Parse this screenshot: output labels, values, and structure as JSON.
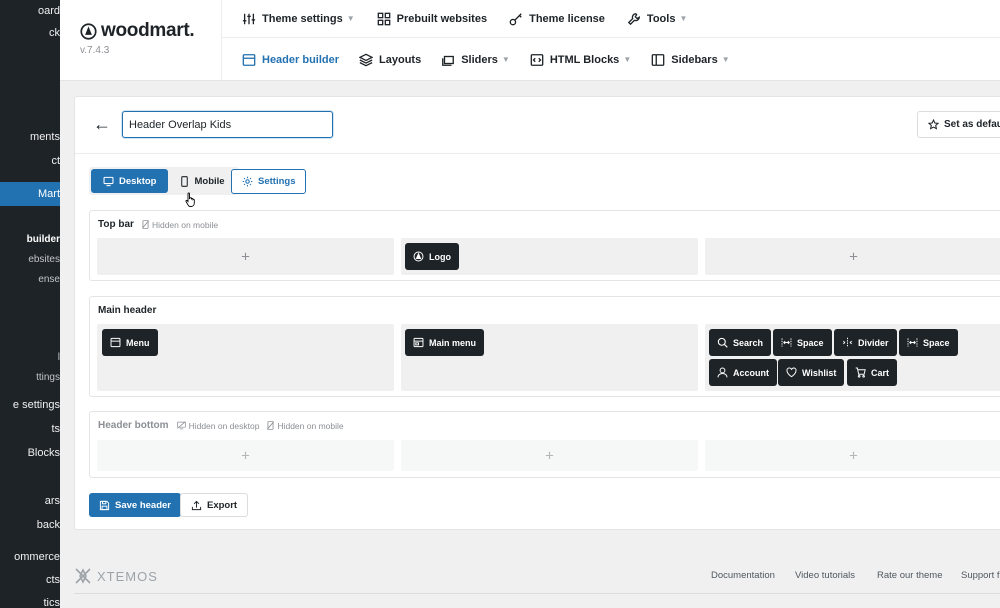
{
  "admin_menu": {
    "items": [
      {
        "label": "oard"
      },
      {
        "label": "ck"
      },
      {
        "label": "ments"
      },
      {
        "label": "ct"
      },
      {
        "label": "Mart"
      },
      {
        "label": "builder"
      },
      {
        "label": "ebsites"
      },
      {
        "label": "ense"
      },
      {
        "label": "l"
      },
      {
        "label": "ttings"
      },
      {
        "label": "e settings"
      },
      {
        "label": "ts"
      },
      {
        "label": " Blocks"
      },
      {
        "label": "ars"
      },
      {
        "label": "back"
      },
      {
        "label": "ommerce"
      },
      {
        "label": "cts"
      },
      {
        "label": "tics"
      }
    ]
  },
  "brand": {
    "name": "woodmart.",
    "version": "v.7.4.3"
  },
  "top_nav": [
    {
      "label": "Theme settings",
      "icon": "sliders-icon",
      "dropdown": true
    },
    {
      "label": "Prebuilt websites",
      "icon": "grid-icon",
      "dropdown": false
    },
    {
      "label": "Theme license",
      "icon": "key-icon",
      "dropdown": false
    },
    {
      "label": "Tools",
      "icon": "wrench-icon",
      "dropdown": true
    }
  ],
  "sub_nav": [
    {
      "label": "Header builder",
      "icon": "header-icon",
      "active": true
    },
    {
      "label": "Layouts",
      "icon": "layers-icon"
    },
    {
      "label": "Sliders",
      "icon": "slides-icon",
      "dropdown": true
    },
    {
      "label": "HTML Blocks",
      "icon": "code-icon",
      "dropdown": true
    },
    {
      "label": "Sidebars",
      "icon": "sidebar-icon",
      "dropdown": true
    }
  ],
  "editor": {
    "header_name": "Header Overlap Kids",
    "set_default": "Set as default",
    "device_tabs": [
      {
        "label": "Desktop",
        "active": true
      },
      {
        "label": "Mobile",
        "active": false
      }
    ],
    "settings": "Settings",
    "rows": {
      "top_bar": {
        "title": "Top bar",
        "notes": [
          "Hidden on mobile"
        ],
        "elements": {
          "center": [
            "Logo"
          ]
        }
      },
      "main_header": {
        "title": "Main header",
        "elements": {
          "left": [
            "Menu"
          ],
          "center": [
            "Main menu"
          ],
          "right": [
            "Search",
            "Space",
            "Divider",
            "Space",
            "Account",
            "Wishlist",
            "Cart"
          ]
        }
      },
      "header_bottom": {
        "title": "Header bottom",
        "notes": [
          "Hidden on desktop",
          "Hidden on mobile"
        ]
      }
    },
    "plus": "+",
    "save": "Save header",
    "export": "Export"
  },
  "footer": {
    "brand": "XTEMOS",
    "links": [
      "Documentation",
      "Video tutorials",
      "Rate our theme",
      "Support f"
    ]
  },
  "colors": {
    "primary": "#2271b1",
    "dark": "#1d2327",
    "admin_bg": "#1d2327"
  }
}
